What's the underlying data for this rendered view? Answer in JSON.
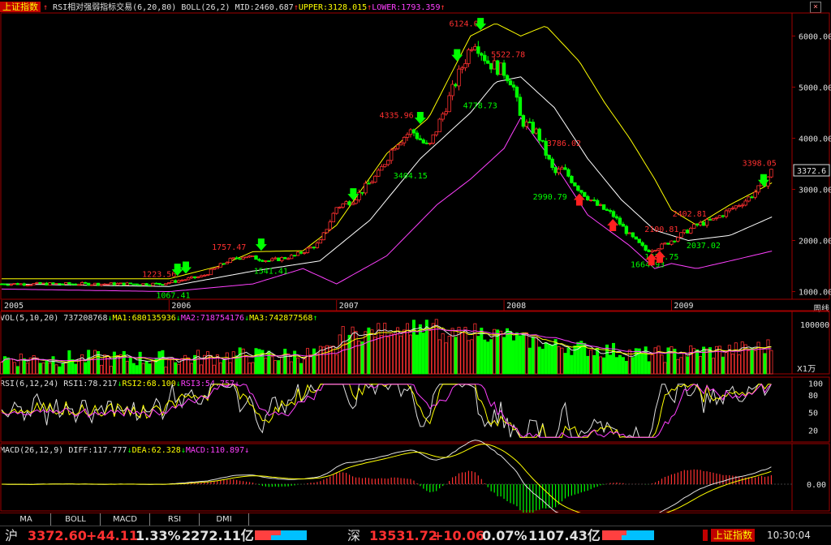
{
  "header": {
    "index_name": "上证指数",
    "indicator": "RSI相对强弱指标交易",
    "indicator_params": "(6,20,80)",
    "boll_label": "BOLL(26,2)",
    "mid": "MID:2460.687",
    "upper": "UPPER:3128.015",
    "lower": "LOWER:1793.359"
  },
  "vol_header": {
    "label": "VOL(5,10,20)",
    "value": "737208768",
    "ma1": "MA1:680135936",
    "ma2": "MA2:718754176",
    "ma3": "MA3:742877568"
  },
  "rsi_header": {
    "label": "RSI(6,12,24)",
    "rsi1": "RSI1:78.217",
    "rsi2": "RSI2:68.100",
    "rsi3": "RSI3:54.757"
  },
  "macd_header": {
    "label": "MACD(26,12,9)",
    "diff": "DIFF:117.777",
    "dea": "DEA:62.328",
    "macd": "MACD:110.897"
  },
  "period_label": "周线",
  "vol_unit": "X1万",
  "current_price_tag": "3372.6",
  "tabs": [
    "MA",
    "BOLL",
    "MACD",
    "RSI",
    "DMI"
  ],
  "status": {
    "sh_label": "沪",
    "sh_price": "3372.60",
    "sh_change": "+44.11",
    "sh_pct": "1.33%",
    "sh_amount": "2272.11亿",
    "sz_label": "深",
    "sz_price": "13531.72",
    "sz_change": "+10.06",
    "sz_pct": "0.07%",
    "sz_amount": "1107.43亿",
    "index_name": "上证指数",
    "time": "10:30:04"
  },
  "colors": {
    "up": "#ff3030",
    "down": "#00ff00",
    "boll_upper": "#ffff00",
    "boll_mid": "#ffffff",
    "boll_lower": "#ff40ff"
  },
  "chart_data": [
    {
      "type": "candlestick",
      "title": "上证指数 周线",
      "x_ticks": [
        "2005",
        "2006",
        "2007",
        "2008",
        "2009"
      ],
      "y_ticks": [
        1000,
        2000,
        3000,
        4000,
        5000,
        6000
      ],
      "ylim": [
        850,
        6450
      ],
      "annotations": [
        {
          "text": "1223.56",
          "date": "2005-12",
          "value": 1223.56,
          "color": "red"
        },
        {
          "text": "1067.41",
          "date": "2006-01",
          "value": 1067.41,
          "color": "green"
        },
        {
          "text": "1757.47",
          "date": "2006-05",
          "value": 1757.47,
          "color": "red"
        },
        {
          "text": "1541.41",
          "date": "2006-08",
          "value": 1541.41,
          "color": "green"
        },
        {
          "text": "4335.96",
          "date": "2007-05",
          "value": 4335.96,
          "color": "red"
        },
        {
          "text": "3404.15",
          "date": "2007-06",
          "value": 3404.15,
          "color": "green"
        },
        {
          "text": "6124.04",
          "date": "2007-10",
          "value": 6124.04,
          "color": "red"
        },
        {
          "text": "5522.78",
          "date": "2008-01",
          "value": 5522.78,
          "color": "red"
        },
        {
          "text": "4778.73",
          "date": "2007-11",
          "value": 4778.73,
          "color": "green"
        },
        {
          "text": "3786.02",
          "date": "2008-05",
          "value": 3786.02,
          "color": "red"
        },
        {
          "text": "2990.79",
          "date": "2008-04",
          "value": 2990.79,
          "color": "green"
        },
        {
          "text": "1664.93",
          "date": "2008-11",
          "value": 1664.93,
          "color": "green"
        },
        {
          "text": "2100.81",
          "date": "2008-12",
          "value": 2100.81,
          "color": "red"
        },
        {
          "text": "1814.75",
          "date": "2008-12",
          "value": 1814.75,
          "color": "green"
        },
        {
          "text": "2402.81",
          "date": "2009-02",
          "value": 2402.81,
          "color": "red"
        },
        {
          "text": "2037.02",
          "date": "2009-03",
          "value": 2037.02,
          "color": "green"
        },
        {
          "text": "3398.05",
          "date": "2009-07",
          "value": 3398.05,
          "color": "red"
        }
      ],
      "close_path": [
        [
          2005.95,
          1150
        ],
        [
          2006.0,
          1180
        ],
        [
          2006.2,
          1300
        ],
        [
          2006.35,
          1600
        ],
        [
          2006.45,
          1700
        ],
        [
          2006.6,
          1600
        ],
        [
          2006.75,
          1700
        ],
        [
          2006.9,
          1950
        ],
        [
          2007.0,
          2650
        ],
        [
          2007.1,
          2800
        ],
        [
          2007.25,
          3300
        ],
        [
          2007.35,
          3900
        ],
        [
          2007.45,
          4150
        ],
        [
          2007.55,
          3800
        ],
        [
          2007.65,
          4600
        ],
        [
          2007.75,
          5400
        ],
        [
          2007.82,
          5950
        ],
        [
          2007.9,
          5500
        ],
        [
          2008.0,
          5300
        ],
        [
          2008.05,
          5100
        ],
        [
          2008.1,
          4350
        ],
        [
          2008.2,
          4100
        ],
        [
          2008.3,
          3300
        ],
        [
          2008.35,
          3400
        ],
        [
          2008.45,
          3000
        ],
        [
          2008.55,
          2700
        ],
        [
          2008.65,
          2500
        ],
        [
          2008.75,
          2100
        ],
        [
          2008.85,
          1800
        ],
        [
          2008.95,
          1900
        ],
        [
          2009.05,
          2100
        ],
        [
          2009.15,
          2300
        ],
        [
          2009.25,
          2400
        ],
        [
          2009.35,
          2600
        ],
        [
          2009.45,
          2800
        ],
        [
          2009.55,
          3100
        ],
        [
          2009.6,
          3372.6
        ]
      ],
      "boll_upper": [
        [
          2005.0,
          1250
        ],
        [
          2006.0,
          1250
        ],
        [
          2006.3,
          1500
        ],
        [
          2006.5,
          1780
        ],
        [
          2006.8,
          1800
        ],
        [
          2007.0,
          2300
        ],
        [
          2007.3,
          3700
        ],
        [
          2007.55,
          4400
        ],
        [
          2007.8,
          6000
        ],
        [
          2007.95,
          6250
        ],
        [
          2008.1,
          6000
        ],
        [
          2008.25,
          6200
        ],
        [
          2008.45,
          5500
        ],
        [
          2008.6,
          4700
        ],
        [
          2008.75,
          4000
        ],
        [
          2008.9,
          3200
        ],
        [
          2009.0,
          2600
        ],
        [
          2009.15,
          2300
        ],
        [
          2009.35,
          2700
        ],
        [
          2009.6,
          3128
        ]
      ],
      "boll_mid": [
        [
          2005.0,
          1150
        ],
        [
          2006.0,
          1100
        ],
        [
          2006.5,
          1400
        ],
        [
          2006.9,
          1600
        ],
        [
          2007.2,
          2400
        ],
        [
          2007.5,
          3600
        ],
        [
          2007.8,
          4500
        ],
        [
          2007.95,
          5100
        ],
        [
          2008.1,
          5200
        ],
        [
          2008.3,
          4600
        ],
        [
          2008.5,
          3600
        ],
        [
          2008.7,
          2800
        ],
        [
          2008.9,
          2200
        ],
        [
          2009.1,
          2000
        ],
        [
          2009.35,
          2100
        ],
        [
          2009.6,
          2460
        ]
      ],
      "boll_lower": [
        [
          2005.0,
          1050
        ],
        [
          2006.0,
          1000
        ],
        [
          2006.5,
          1150
        ],
        [
          2006.8,
          1450
        ],
        [
          2007.0,
          1150
        ],
        [
          2007.3,
          1700
        ],
        [
          2007.6,
          2700
        ],
        [
          2007.8,
          3200
        ],
        [
          2008.0,
          3800
        ],
        [
          2008.1,
          4400
        ],
        [
          2008.3,
          3500
        ],
        [
          2008.5,
          2500
        ],
        [
          2008.75,
          1900
        ],
        [
          2008.9,
          1450
        ],
        [
          2009.0,
          1550
        ],
        [
          2009.15,
          1450
        ],
        [
          2009.35,
          1600
        ],
        [
          2009.6,
          1793
        ]
      ],
      "buy_signals": [
        2008.45,
        2008.65,
        2008.88,
        2008.93
      ],
      "sell_signals": [
        2006.05,
        2006.1,
        2006.55,
        2007.1,
        2007.5,
        2007.72,
        2007.86,
        2009.55
      ]
    },
    {
      "type": "bar",
      "title": "VOL",
      "y_ticks": [
        100000
      ],
      "ylim": [
        0,
        120000
      ],
      "last_value": 73720.88
    },
    {
      "type": "line",
      "title": "RSI",
      "y_ticks": [
        20,
        50,
        80,
        100
      ],
      "ylim": [
        0,
        110
      ],
      "rsi1_last": 78.217,
      "rsi2_last": 68.1,
      "rsi3_last": 54.757
    },
    {
      "type": "line",
      "title": "MACD",
      "y_ticks": [
        0
      ],
      "diff_last": 117.777,
      "dea_last": 62.328,
      "macd_last": 110.897
    }
  ]
}
